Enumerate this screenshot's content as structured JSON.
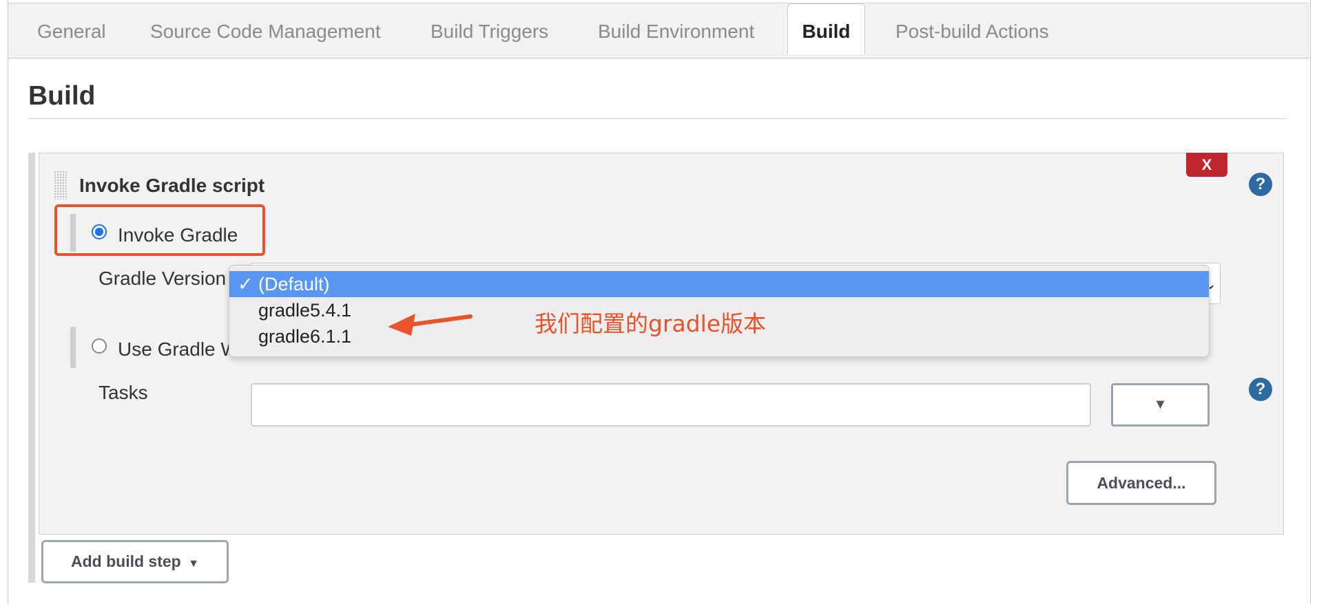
{
  "tabs": [
    {
      "label": "General",
      "active": false
    },
    {
      "label": "Source Code Management",
      "active": false
    },
    {
      "label": "Build Triggers",
      "active": false
    },
    {
      "label": "Build Environment",
      "active": false
    },
    {
      "label": "Build",
      "active": true
    },
    {
      "label": "Post-build Actions",
      "active": false
    }
  ],
  "section": {
    "title": "Build"
  },
  "step": {
    "title": "Invoke Gradle script",
    "delete_label": "X",
    "help_label": "?",
    "options": [
      {
        "label": "Invoke Gradle",
        "selected": true
      },
      {
        "label": "Use Gradle W",
        "selected": false
      }
    ],
    "gradle_version_label": "Gradle Version",
    "gradle_version_dropdown": {
      "checkmark": "✓",
      "options": [
        "(Default)",
        "gradle5.4.1",
        "gradle6.1.1"
      ],
      "selected": "(Default)"
    },
    "tasks_label": "Tasks",
    "tasks_value": "",
    "tasks_expand_icon": "▼",
    "advanced_label": "Advanced..."
  },
  "add_build_step_label": "Add build step",
  "annotation": {
    "text": "我们配置的gradle版本",
    "color": "#e8532a"
  },
  "colors": {
    "highlight": "#e8532a",
    "delete": "#c0262d",
    "help": "#2d6a9f",
    "dropdown_selected": "#5a97f0"
  }
}
